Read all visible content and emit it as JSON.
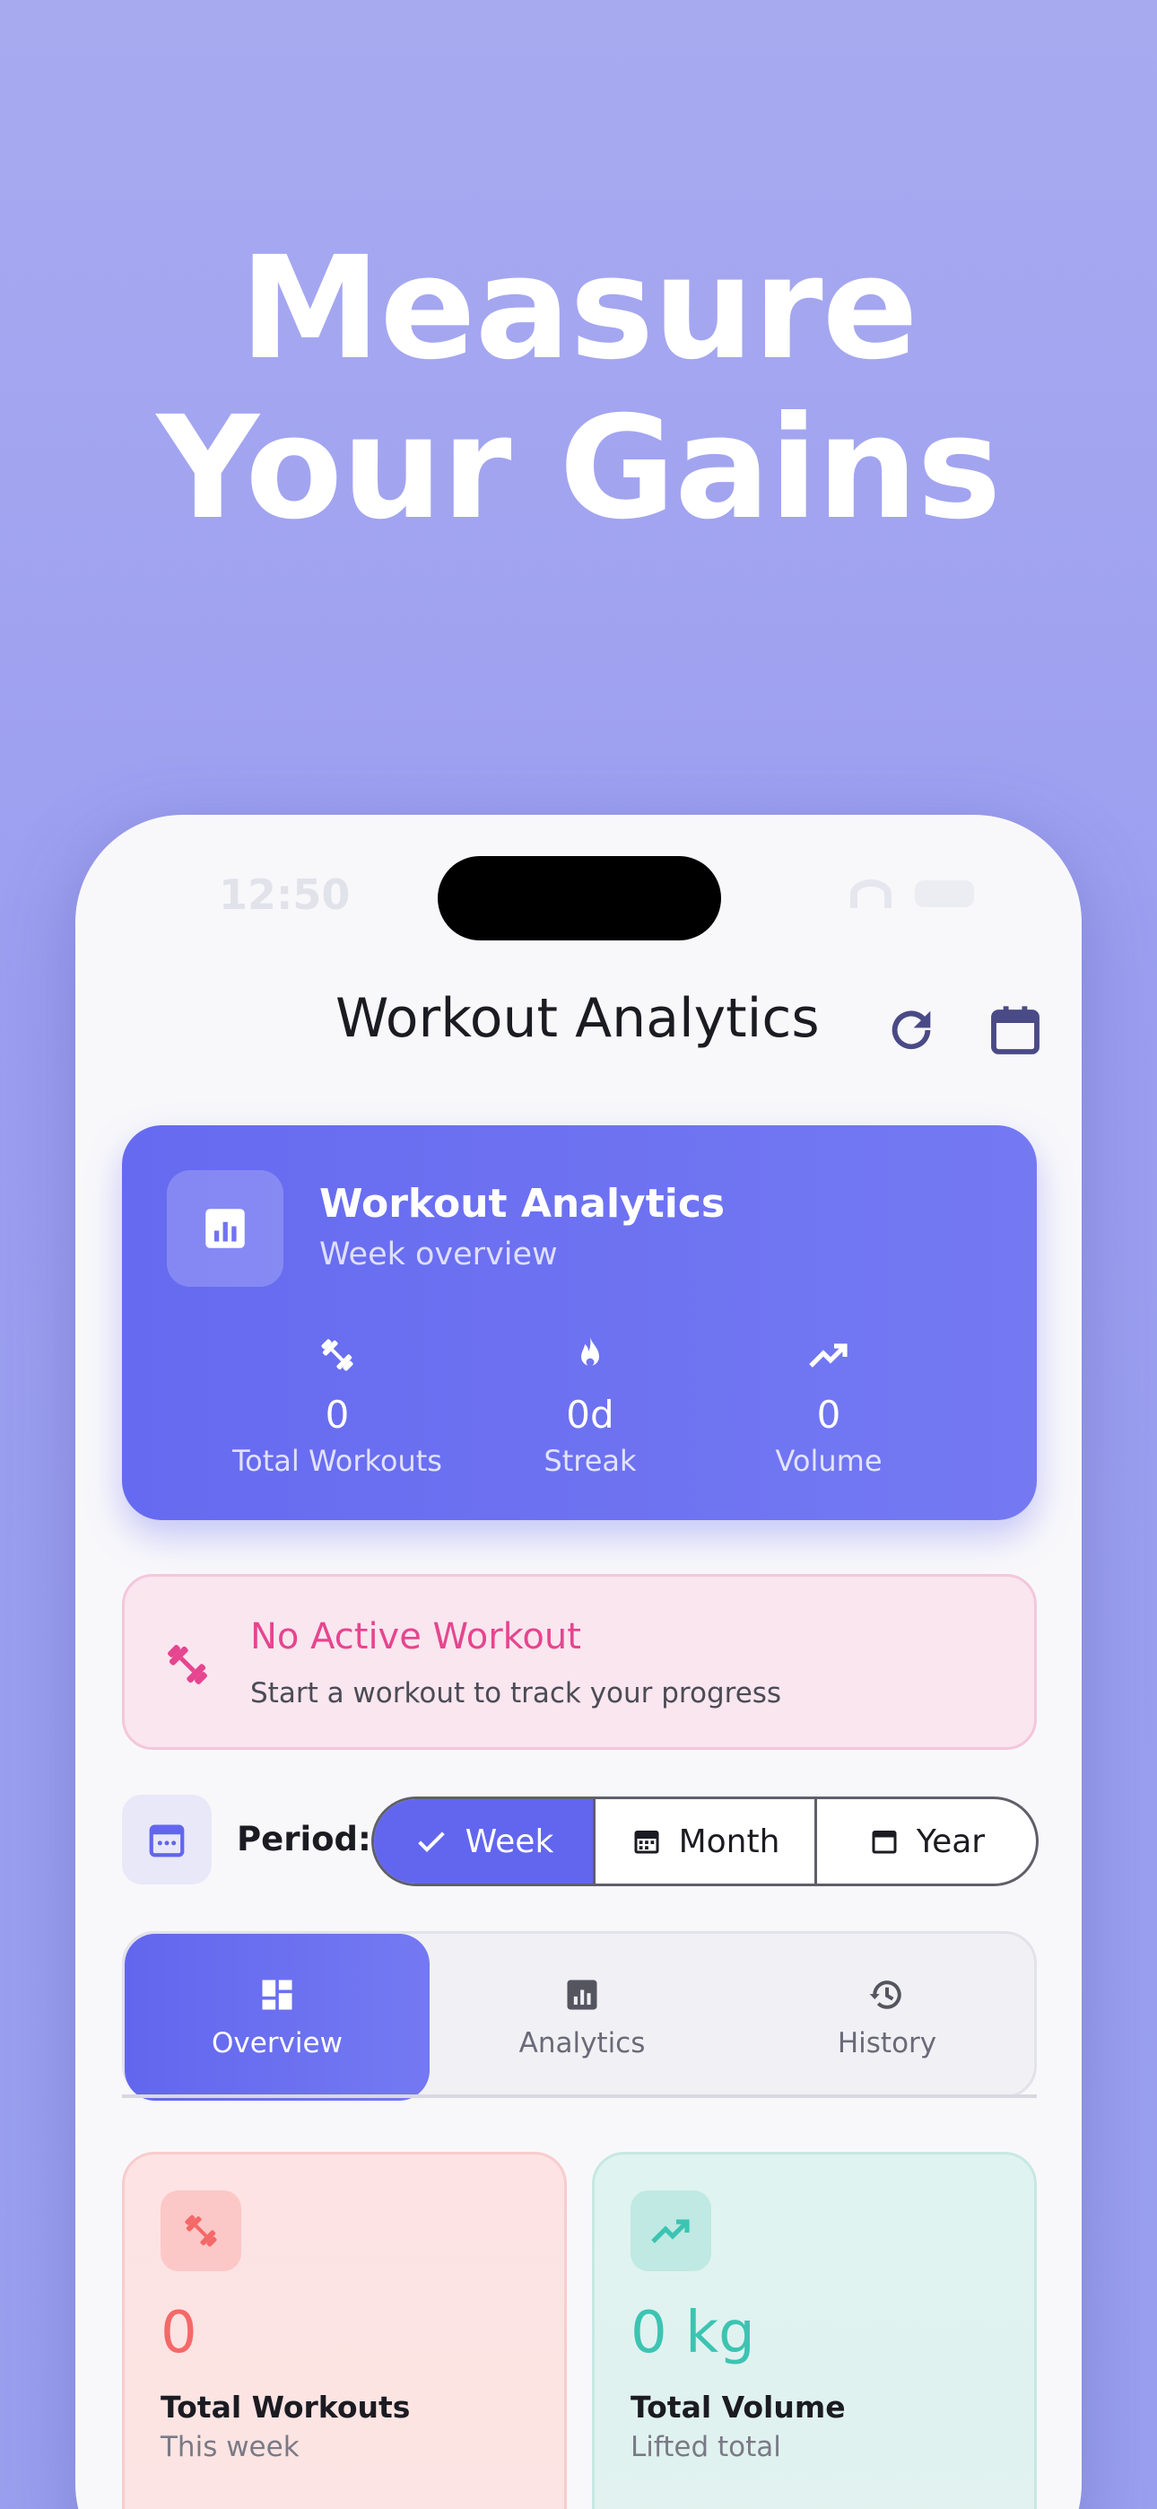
{
  "headline": {
    "line1": "Measure",
    "line2": "Your Gains"
  },
  "status_bar": {
    "time": "12:50"
  },
  "app_bar": {
    "title": "Workout Analytics"
  },
  "hero": {
    "title": "Workout Analytics",
    "subtitle": "Week overview",
    "stats": [
      {
        "value": "0",
        "label": "Total Workouts",
        "icon": "dumbbell-icon"
      },
      {
        "value": "0d",
        "label": "Streak",
        "icon": "flame-icon"
      },
      {
        "value": "0",
        "label": "Volume",
        "icon": "trending-up-icon"
      }
    ]
  },
  "active_workout": {
    "title": "No Active Workout",
    "subtitle": "Start a workout to track your progress"
  },
  "period": {
    "label": "Period:",
    "options": [
      "Week",
      "Month",
      "Year"
    ],
    "selected": "Week"
  },
  "tabs": [
    {
      "label": "Overview",
      "icon": "dashboard-icon",
      "active": true
    },
    {
      "label": "Analytics",
      "icon": "bar-chart-icon",
      "active": false
    },
    {
      "label": "History",
      "icon": "history-icon",
      "active": false
    }
  ],
  "summary_cards": [
    {
      "value": "0",
      "title": "Total Workouts",
      "subtitle": "This week",
      "icon": "dumbbell-icon",
      "color": "#f56868"
    },
    {
      "value": "0 kg",
      "title": "Total Volume",
      "subtitle": "Lifted total",
      "icon": "trending-up-icon",
      "color": "#3cc4b2"
    }
  ],
  "colors": {
    "accent": "#6266ee",
    "pink": "#e6458f",
    "background": "#a8aaf0"
  }
}
